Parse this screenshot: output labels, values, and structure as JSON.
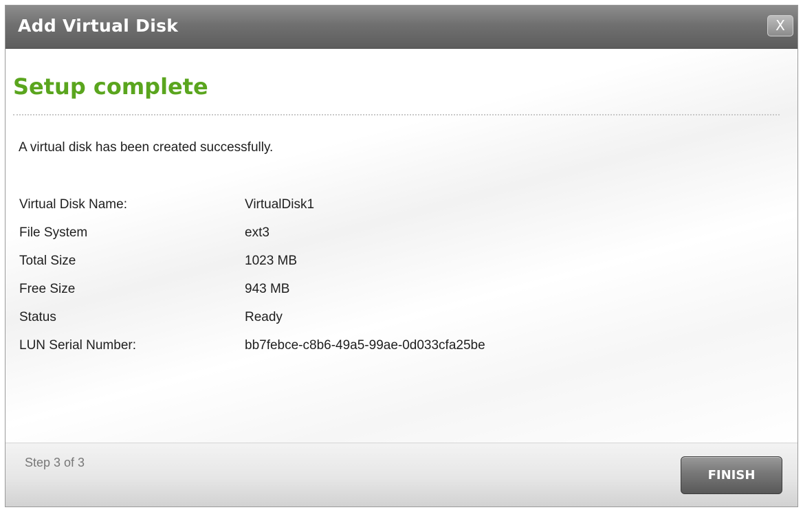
{
  "dialog": {
    "title": "Add Virtual Disk",
    "close_icon": "close-icon",
    "close_label": "X"
  },
  "content": {
    "heading": "Setup complete",
    "heading_color": "#5aa51e",
    "message": "A virtual disk has been created successfully.",
    "details": [
      {
        "label": "Virtual Disk Name:",
        "value": "VirtualDisk1"
      },
      {
        "label": "File System",
        "value": "ext3"
      },
      {
        "label": "Total Size",
        "value": "1023 MB"
      },
      {
        "label": "Free Size",
        "value": "943 MB"
      },
      {
        "label": "Status",
        "value": "Ready"
      },
      {
        "label": "LUN Serial Number:",
        "value": "bb7febce-c8b6-49a5-99ae-0d033cfa25be"
      }
    ]
  },
  "footer": {
    "step_text": "Step 3 of 3",
    "finish_label": "FINISH"
  }
}
